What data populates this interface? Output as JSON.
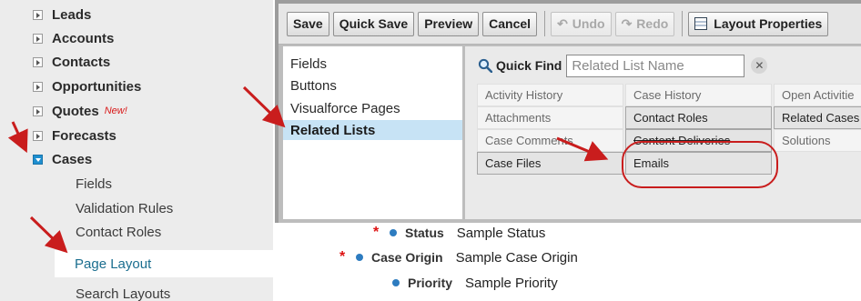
{
  "sidebar": {
    "top_items": [
      {
        "label": "Leads"
      },
      {
        "label": "Accounts"
      },
      {
        "label": "Contacts"
      },
      {
        "label": "Opportunities"
      },
      {
        "label": "Quotes",
        "badge": "New!"
      },
      {
        "label": "Forecasts"
      },
      {
        "label": "Cases",
        "expanded": true
      }
    ],
    "cases_children": [
      "Fields",
      "Validation Rules",
      "Contact Roles"
    ],
    "selected_child": "Page Layout",
    "next_child": "Search Layouts"
  },
  "toolbar": {
    "save": "Save",
    "quick_save": "Quick Save",
    "preview": "Preview",
    "cancel": "Cancel",
    "undo": "Undo",
    "redo": "Redo",
    "layout_properties": "Layout Properties"
  },
  "categories": {
    "items": [
      "Fields",
      "Buttons",
      "Visualforce Pages",
      "Related Lists"
    ],
    "selected": "Related Lists"
  },
  "quick_find": {
    "label": "Quick Find",
    "placeholder": "Related List Name",
    "clear_icon": "✕"
  },
  "palette": {
    "rows": [
      [
        "Activity History",
        "Case History",
        "Open Activitie"
      ],
      [
        "Attachments",
        "Contact Roles",
        "Related Cases"
      ],
      [
        "Case Comments",
        "Content Deliveries",
        "Solutions"
      ],
      [
        "Case Files",
        "Emails",
        ""
      ]
    ],
    "placed": [
      "Contact Roles",
      "Related Cases",
      "Content Deliveries",
      "Case Files",
      "Emails"
    ]
  },
  "detail": {
    "rows": [
      {
        "label": "Status",
        "value": "Sample Status",
        "required": true
      },
      {
        "label": "Case Origin",
        "value": "Sample Case Origin",
        "required": true
      },
      {
        "label": "Priority",
        "value": "Sample Priority",
        "required": false
      }
    ]
  },
  "colors": {
    "annotation": "#c91d1d",
    "selected_bg": "#c7e3f5",
    "link": "#1b6e8f",
    "required": "#dd1111",
    "field_dot": "#2d7cc0"
  }
}
